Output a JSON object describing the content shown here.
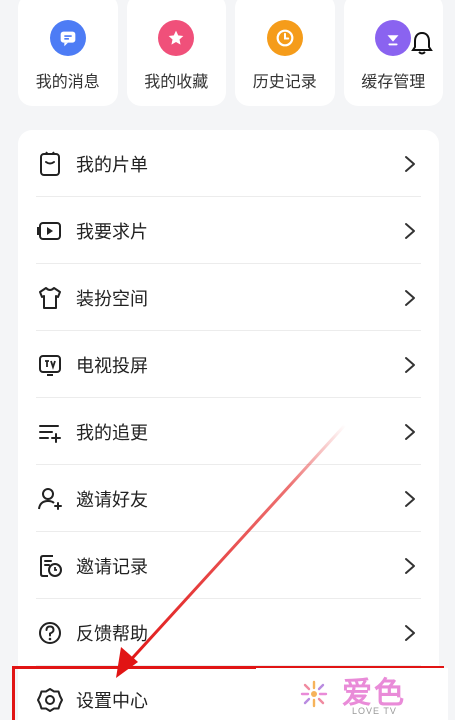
{
  "tiles": [
    {
      "label": "我的消息",
      "icon": "message-icon",
      "color": "#4d7cf5"
    },
    {
      "label": "我的收藏",
      "icon": "star-icon",
      "color": "#f0507a"
    },
    {
      "label": "历史记录",
      "icon": "clock-icon",
      "color": "#f59c1a"
    },
    {
      "label": "缓存管理",
      "icon": "download-icon",
      "color": "#8a63f0"
    }
  ],
  "bell_icon": "bell-icon",
  "menu": {
    "items": [
      {
        "label": "我的片单",
        "icon": "playlist-icon"
      },
      {
        "label": "我要求片",
        "icon": "video-request-icon"
      },
      {
        "label": "装扮空间",
        "icon": "shirt-icon"
      },
      {
        "label": "电视投屏",
        "icon": "tv-cast-icon"
      },
      {
        "label": "我的追更",
        "icon": "follow-list-icon"
      },
      {
        "label": "邀请好友",
        "icon": "invite-user-icon"
      },
      {
        "label": "邀请记录",
        "icon": "invite-record-icon"
      },
      {
        "label": "反馈帮助",
        "icon": "help-icon"
      },
      {
        "label": "设置中心",
        "icon": "settings-icon"
      }
    ]
  },
  "annotation": {
    "color": "#e11414"
  },
  "watermark": {
    "text": "爱色",
    "sub": "LOVE TV"
  }
}
